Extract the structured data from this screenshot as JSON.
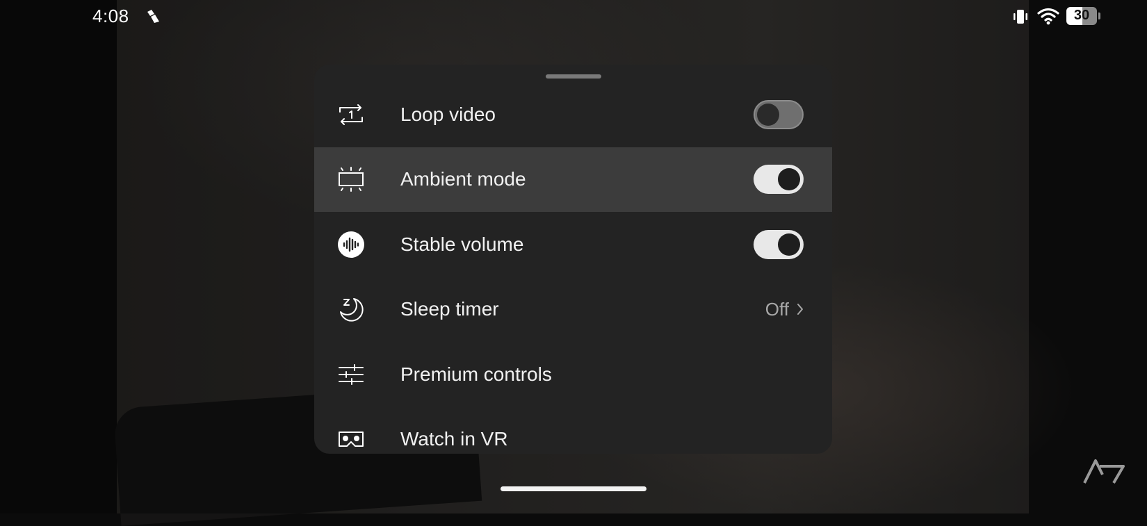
{
  "status_bar": {
    "time": "4:08",
    "battery_level": "30",
    "icons": [
      "app-notification-icon",
      "vibrate-icon",
      "wifi-icon",
      "battery-icon"
    ]
  },
  "menu": {
    "items": [
      {
        "label": "Loop video",
        "icon": "loop-one-icon",
        "control": "toggle",
        "state": "off"
      },
      {
        "label": "Ambient mode",
        "icon": "ambient-screen-icon",
        "control": "toggle",
        "state": "on",
        "highlighted": true
      },
      {
        "label": "Stable volume",
        "icon": "stable-volume-icon",
        "control": "toggle",
        "state": "on"
      },
      {
        "label": "Sleep timer",
        "icon": "sleep-moon-icon",
        "control": "value",
        "value": "Off"
      },
      {
        "label": "Premium controls",
        "icon": "sliders-icon",
        "control": "none"
      },
      {
        "label": "Watch in VR",
        "icon": "vr-headset-icon",
        "control": "none"
      }
    ]
  },
  "colors": {
    "sheet_background": "#232323",
    "highlight_row": "#3c3c3c",
    "toggle_on_track": "#e8e8e8",
    "toggle_off_track": "#6f6f6f"
  }
}
